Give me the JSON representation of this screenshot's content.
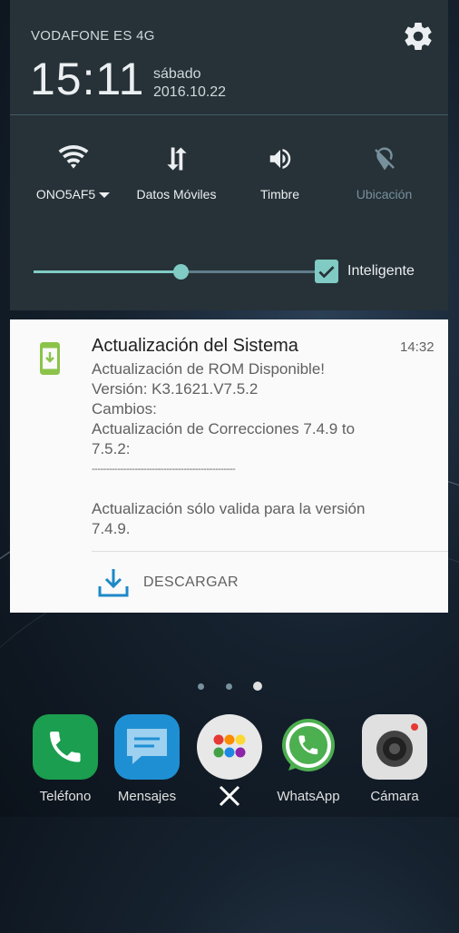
{
  "status": {
    "carrier": "VODAFONE ES 4G"
  },
  "clock": {
    "time": "15:11",
    "day": "sábado",
    "date": "2016.10.22"
  },
  "quick_tiles": [
    {
      "label": "ONO5AF5",
      "icon": "wifi-icon",
      "active": true
    },
    {
      "label": "Datos Móviles",
      "icon": "mobile-data-icon",
      "active": true
    },
    {
      "label": "Timbre",
      "icon": "volume-icon",
      "active": true
    },
    {
      "label": "Ubicación",
      "icon": "location-off-icon",
      "active": false
    }
  ],
  "brightness": {
    "level": 0.51,
    "auto_label": "Inteligente",
    "auto_checked": true
  },
  "notification": {
    "title": "Actualización del Sistema",
    "time": "14:32",
    "lines": [
      "Actualización de ROM Disponible!",
      "Versión: K3.1621.V7.5.2",
      "Cambios:",
      "Actualización de Correcciones 7.4.9 to",
      "7.5.2:",
      "--------------------------------------------------",
      "",
      "Actualización sólo valida para la versión",
      "7.4.9."
    ],
    "action_label": "DESCARGAR"
  },
  "home": {
    "page_count": 3,
    "active_page": 3
  },
  "dock": [
    {
      "label": "Teléfono",
      "icon": "phone-icon",
      "color": "#1b9e4f"
    },
    {
      "label": "Mensajes",
      "icon": "messages-icon",
      "color": "#1f8fd3"
    },
    {
      "label": "",
      "icon": "apps-close-icon",
      "color": "#e8e8e8"
    },
    {
      "label": "WhatsApp",
      "icon": "whatsapp-icon",
      "color": "#4caf50"
    },
    {
      "label": "Cámara",
      "icon": "camera-icon",
      "color": "#e0e0e0"
    }
  ],
  "colors": {
    "accent": "#80cbc4",
    "panel": "#263238",
    "card": "#fafafa",
    "app_icon": "#8bc34a",
    "download": "#1e88c8"
  }
}
